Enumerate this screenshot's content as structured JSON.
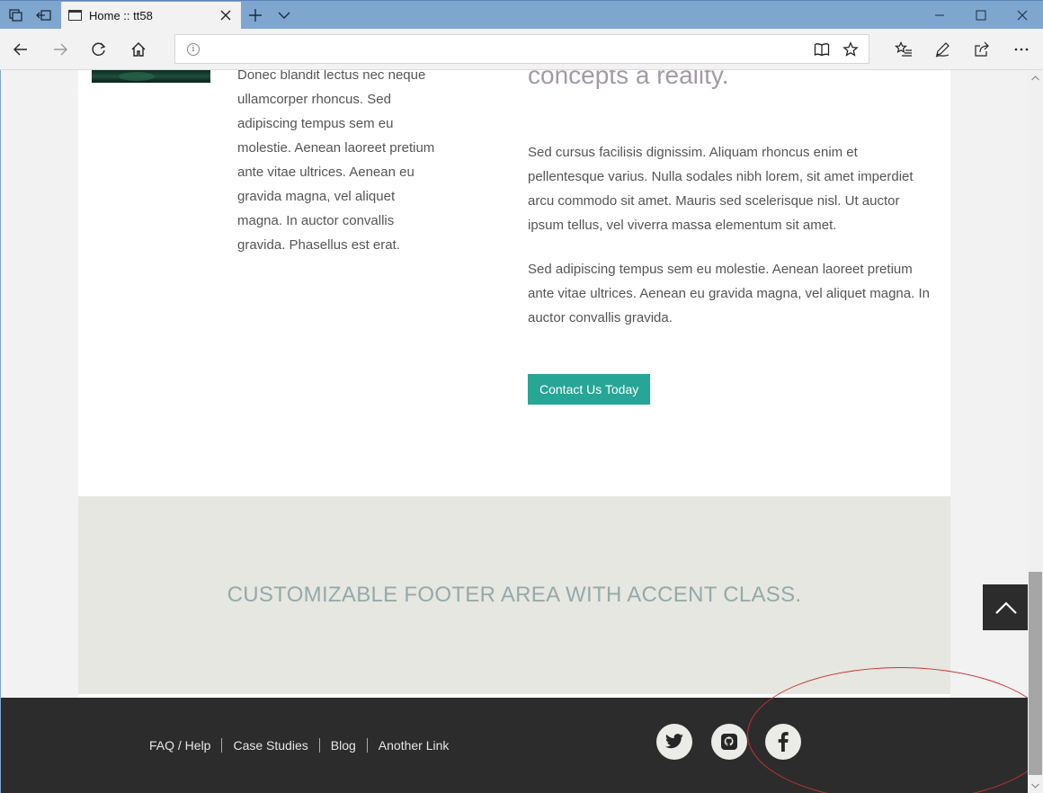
{
  "browser": {
    "tab_title": "Home :: tt58",
    "address_value": "",
    "icons": {
      "tab_actions": "tab-actions-icon",
      "set_aside": "set-aside-tabs-icon",
      "page": "page-icon",
      "close_tab": "close-icon",
      "new_tab": "plus-icon",
      "tab_list": "chevron-down-icon",
      "minimize": "minimize-icon",
      "maximize": "maximize-icon",
      "close_window": "close-icon",
      "back": "back-arrow-icon",
      "forward": "forward-arrow-icon",
      "refresh": "refresh-icon",
      "home": "home-icon",
      "site_info": "info-icon",
      "reading_view": "book-icon",
      "favorite": "star-icon",
      "favorites_hub": "favorites-list-icon",
      "web_note": "pen-icon",
      "share": "share-icon",
      "more": "ellipsis-icon"
    }
  },
  "page": {
    "left_column_text": "Donec blandit lectus nec neque ullamcorper rhoncus. Sed adipiscing tempus sem eu molestie. Aenean laoreet pretium ante vitae ultrices. Aenean eu gravida magna, vel aliquet magna. In auctor convallis gravida. Phasellus est erat.",
    "heading": "concepts a reality.",
    "paragraph_1": "Sed cursus facilisis dignissim. Aliquam rhoncus enim et pellentesque varius. Nulla sodales nibh lorem, sit amet imperdiet arcu commodo sit amet. Mauris sed scelerisque nisl. Ut auctor ipsum tellus, vel viverra massa elementum sit amet.",
    "paragraph_2": "Sed adipiscing tempus sem eu molestie. Aenean laoreet pretium ante vitae ultrices. Aenean eu gravida magna, vel aliquet magna. In auctor convallis gravida.",
    "cta_label": "Contact Us Today",
    "accent_footer_text": "CUSTOMIZABLE FOOTER AREA WITH ACCENT CLASS.",
    "footer_links": [
      "FAQ / Help",
      "Case Studies",
      "Blog",
      "Another Link"
    ],
    "social_icons": [
      "twitter-icon",
      "github-icon",
      "facebook-icon"
    ],
    "back_to_top_icon": "chevron-up-icon"
  },
  "colors": {
    "titlebar": "#7fa6cf",
    "heading": "#a29aa6",
    "cta_bg": "#27a597",
    "accent_footer_bg": "#e6e7e1",
    "accent_footer_text": "#95a9ab",
    "dark_footer_bg": "#2c2c2c",
    "highlight_ellipse": "#c83232"
  }
}
